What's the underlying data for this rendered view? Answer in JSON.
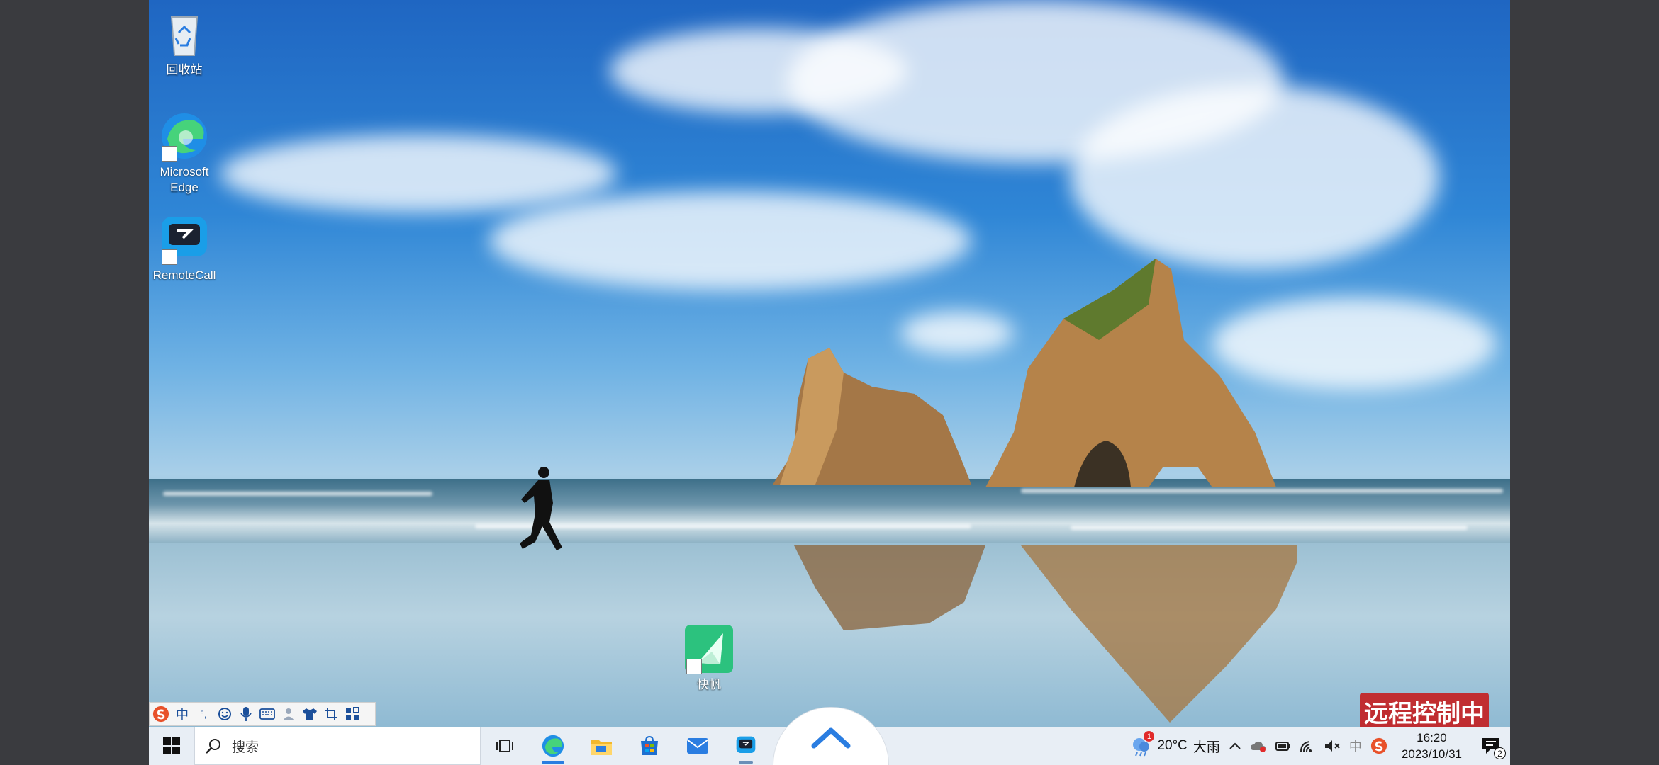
{
  "desktop": {
    "icons": [
      {
        "label": "回收站"
      },
      {
        "label": "Microsoft Edge"
      },
      {
        "label": "RemoteCall"
      },
      {
        "label": "快帆"
      }
    ]
  },
  "remote_badge": "远程控制中",
  "ime_toolbar": {
    "mode_label": "中",
    "punct_label": "°,"
  },
  "taskbar": {
    "search_placeholder": "搜索",
    "weather": {
      "temp": "20°C",
      "condition": "大雨",
      "alert_count": "1"
    },
    "tray": {
      "ime_label": "中"
    },
    "clock": {
      "time": "16:20",
      "date": "2023/10/31"
    },
    "notifications_count": "2"
  }
}
